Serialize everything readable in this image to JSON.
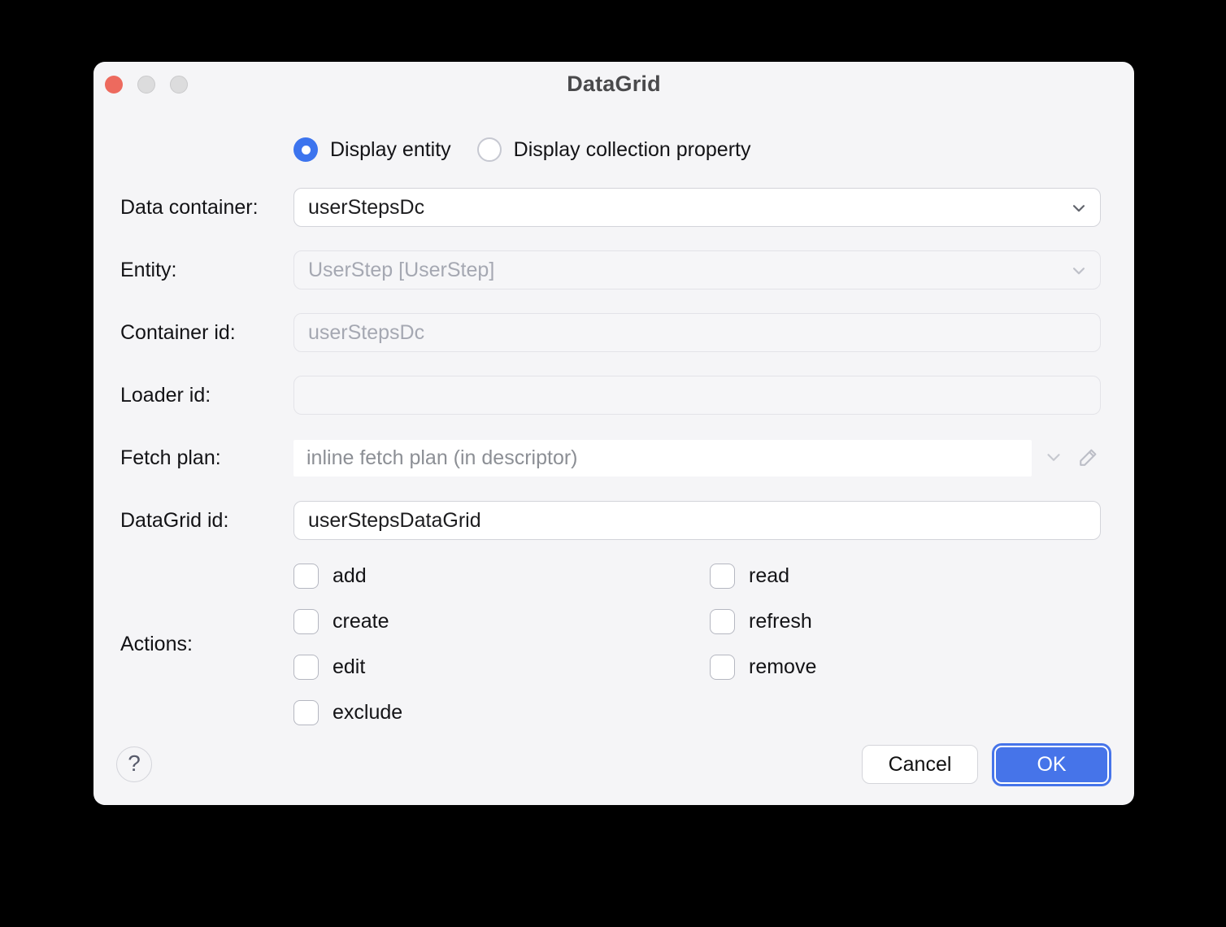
{
  "window": {
    "title": "DataGrid"
  },
  "radio_group": {
    "options": [
      {
        "label": "Display entity",
        "selected": true
      },
      {
        "label": "Display collection property",
        "selected": false
      }
    ]
  },
  "fields": {
    "data_container": {
      "label": "Data container:",
      "value": "userStepsDc",
      "disabled": false
    },
    "entity": {
      "label": "Entity:",
      "value": "UserStep [UserStep]",
      "disabled": true
    },
    "container_id": {
      "label": "Container id:",
      "value": "userStepsDc",
      "disabled": true
    },
    "loader_id": {
      "label": "Loader id:",
      "value": "",
      "disabled": false
    },
    "fetch_plan": {
      "label": "Fetch plan:",
      "value": "",
      "placeholder": "inline fetch plan (in descriptor)"
    },
    "datagrid_id": {
      "label": "DataGrid id:",
      "value": "userStepsDataGrid",
      "disabled": false
    }
  },
  "actions": {
    "label": "Actions:",
    "left": [
      {
        "label": "add",
        "checked": false
      },
      {
        "label": "create",
        "checked": false
      },
      {
        "label": "edit",
        "checked": false
      },
      {
        "label": "exclude",
        "checked": false
      }
    ],
    "right": [
      {
        "label": "read",
        "checked": false
      },
      {
        "label": "refresh",
        "checked": false
      },
      {
        "label": "remove",
        "checked": false
      }
    ]
  },
  "footer": {
    "help_label": "?",
    "cancel_label": "Cancel",
    "ok_label": "OK"
  },
  "icons": {
    "data_container_field": "chevron-down",
    "entity_field": "chevron-down",
    "fetch_plan_field": "chevron-down",
    "fetch_plan_edit": "pencil",
    "help": "question-mark-circle"
  },
  "colors": {
    "dialog_bg": "#f5f5f7",
    "accent_blue": "#4674e9",
    "radio_blue": "#3c74ee",
    "close_red": "#ed6a5e",
    "disabled_text": "#a5a8b2",
    "placeholder_text": "#8c8f95"
  }
}
